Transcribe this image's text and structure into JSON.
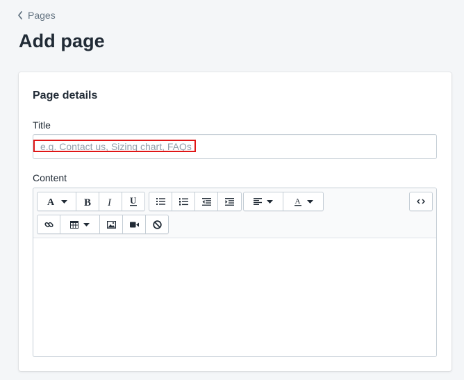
{
  "breadcrumb": {
    "label": "Pages"
  },
  "page": {
    "title": "Add page"
  },
  "card": {
    "title": "Page details",
    "title_field": {
      "label": "Title",
      "placeholder": "e.g. Contact us, Sizing chart, FAQs",
      "value": ""
    },
    "content_field": {
      "label": "Content"
    }
  },
  "toolbar": {
    "row1": [
      {
        "icon": "font-family-icon",
        "dropdown": true
      },
      {
        "icon": "bold-icon"
      },
      {
        "icon": "italic-icon"
      },
      {
        "icon": "underline-icon"
      },
      {
        "icon": "bullet-list-icon"
      },
      {
        "icon": "numbered-list-icon"
      },
      {
        "icon": "outdent-icon"
      },
      {
        "icon": "indent-icon"
      },
      {
        "icon": "align-left-icon",
        "dropdown": true
      },
      {
        "icon": "text-color-icon",
        "dropdown": true
      },
      {
        "icon": "code-view-icon"
      }
    ],
    "row2": [
      {
        "icon": "link-icon"
      },
      {
        "icon": "table-icon",
        "dropdown": true
      },
      {
        "icon": "image-icon"
      },
      {
        "icon": "video-icon"
      },
      {
        "icon": "clear-formatting-icon"
      }
    ]
  },
  "colors": {
    "highlight": "#e01616",
    "text": "#212b36",
    "muted": "#637381",
    "border": "#c4cdd5"
  }
}
